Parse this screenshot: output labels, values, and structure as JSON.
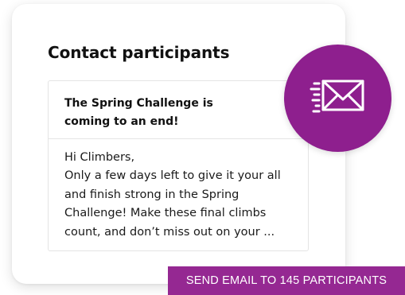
{
  "contact": {
    "title": "Contact participants",
    "subject": "The Spring Challenge is coming to an end!",
    "body_lines": [
      "Hi Climbers,",
      "Only a few days left to give it your all",
      "and finish strong in the Spring",
      "Challenge! Make these final climbs",
      "count, and don’t miss out on your ..."
    ]
  },
  "badge": {
    "icon": "fast-mail-icon",
    "color": "#8e1f8e"
  },
  "send_button": {
    "label": "SEND EMAIL TO 145 PARTICIPANTS",
    "color": "#952892"
  }
}
